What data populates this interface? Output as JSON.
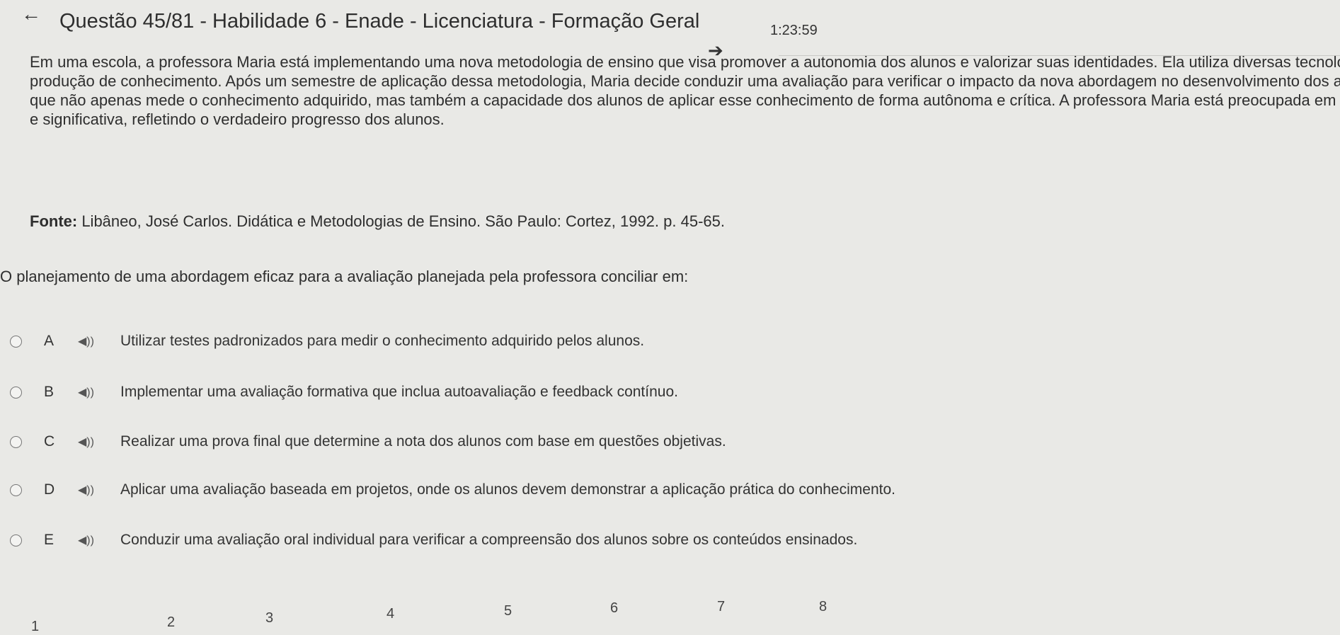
{
  "header": {
    "back_icon": "←",
    "title": "Questão 45/81 - Habilidade 6 - Enade - Licenciatura - Formação Geral",
    "next_icon": "➔",
    "timer": "1:23:59"
  },
  "statement": {
    "lines": [
      "Em uma escola, a professora Maria está implementando uma nova metodologia de ensino que visa promover a autonomia dos alunos e valorizar suas identidades. Ela utiliza diversas tecnologias e lingu",
      "produção de conhecimento. Após um semestre de aplicação dessa metodologia, Maria decide conduzir uma avaliação para verificar o impacto da nova abordagem no desenvolvimento dos alunos. Ela p",
      "que não apenas mede o conhecimento adquirido, mas também a capacidade dos alunos de aplicar esse conhecimento de forma autônoma e crítica. A professora Maria está preocupada em garantir que",
      "e significativa, refletindo o verdadeiro progresso dos alunos."
    ]
  },
  "source": {
    "label": "Fonte:",
    "text": " Libâneo, José Carlos. Didática e Metodologias de Ensino. São Paulo: Cortez, 1992. p. 45-65."
  },
  "question": "O planejamento de uma abordagem eficaz para a avaliação planejada pela professora conciliar em:",
  "audio_icon": "◀))",
  "options": [
    {
      "letter": "A",
      "text": "Utilizar testes padronizados para medir o conhecimento adquirido pelos alunos."
    },
    {
      "letter": "B",
      "text": "Implementar uma avaliação formativa que inclua autoavaliação e feedback contínuo."
    },
    {
      "letter": "C",
      "text": "Realizar uma prova final que determine a nota dos alunos com base em questões objetivas."
    },
    {
      "letter": "D",
      "text": "Aplicar uma avaliação baseada em projetos, onde os alunos devem demonstrar a aplicação prática do conhecimento."
    },
    {
      "letter": "E",
      "text": "Conduzir uma avaliação oral individual para verificar a compreensão dos alunos sobre os conteúdos ensinados."
    }
  ],
  "pagination": [
    "1",
    "2",
    "3",
    "4",
    "5",
    "6",
    "7",
    "8"
  ]
}
